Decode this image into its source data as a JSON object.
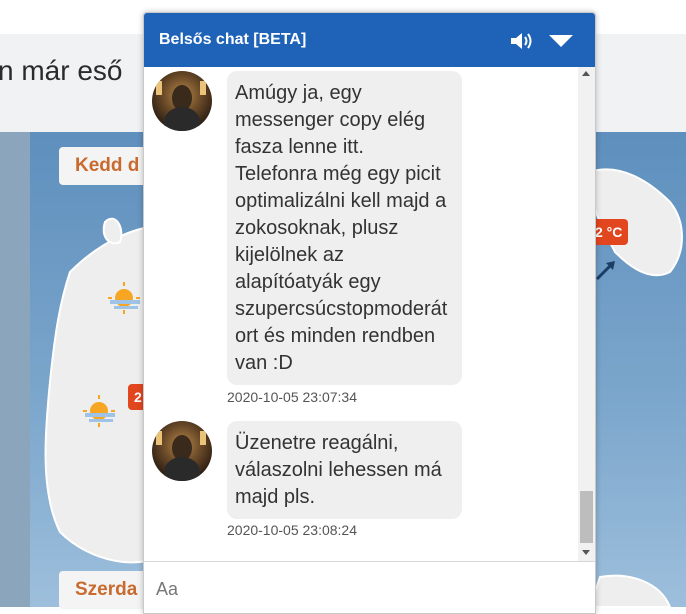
{
  "page": {
    "headline": "n már eső",
    "day_labels": [
      "Kedd d",
      "Szerda"
    ],
    "temp_badges": [
      "2 °C",
      "2"
    ]
  },
  "chat": {
    "title": "Belsős chat [BETA]",
    "icons": {
      "speaker": "speaker-icon",
      "collapse": "chevron-down-icon"
    },
    "messages": [
      {
        "text": "Amúgy ja, egy\nmessenger copy elég\nfasza lenne itt.\nTelefonra még egy picit\noptimalizálni kell majd a\nzokosoknak, plusz\nkijelölnek az\nalapítóatyák egy\nszupercsúcstopmoderát\nort és minden rendben\nvan :D",
        "timestamp": "2020-10-05 23:07:34"
      },
      {
        "text": "Üzenetre reagálni,\nválaszolni lehessen má\nmajd pls.",
        "timestamp": "2020-10-05 23:08:24"
      }
    ],
    "input_placeholder": "Aa"
  },
  "colors": {
    "header": "#1f63b8",
    "bubble": "#efefef",
    "day_label_text": "#c96a2e",
    "temp_badge": "#e2461e"
  }
}
